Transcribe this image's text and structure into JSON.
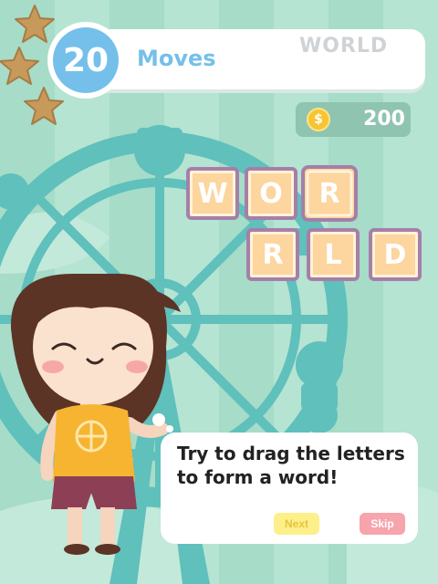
{
  "hud": {
    "moves_count": "20",
    "moves_label": "Moves",
    "target_word": "WORLD",
    "coin_symbol": "$",
    "coins": "200",
    "stars_earned": 3,
    "stars_total": 3
  },
  "board": {
    "row1": [
      "W",
      "O",
      "R"
    ],
    "row2": [
      "R",
      "L",
      "D"
    ]
  },
  "tutorial": {
    "message": "Try to drag the letters to form a word!",
    "next_label": "Next",
    "skip_label": "Skip"
  },
  "colors": {
    "background_stripe_a": "#a6dcc8",
    "background_stripe_b": "#b5e4d2",
    "moves_accent": "#74c0ea",
    "tile_fill": "#fdd59e",
    "tile_border": "#a67fa8",
    "next_button": "#fdf08a",
    "skip_button": "#f7a4ad",
    "coin": "#f7c531"
  }
}
